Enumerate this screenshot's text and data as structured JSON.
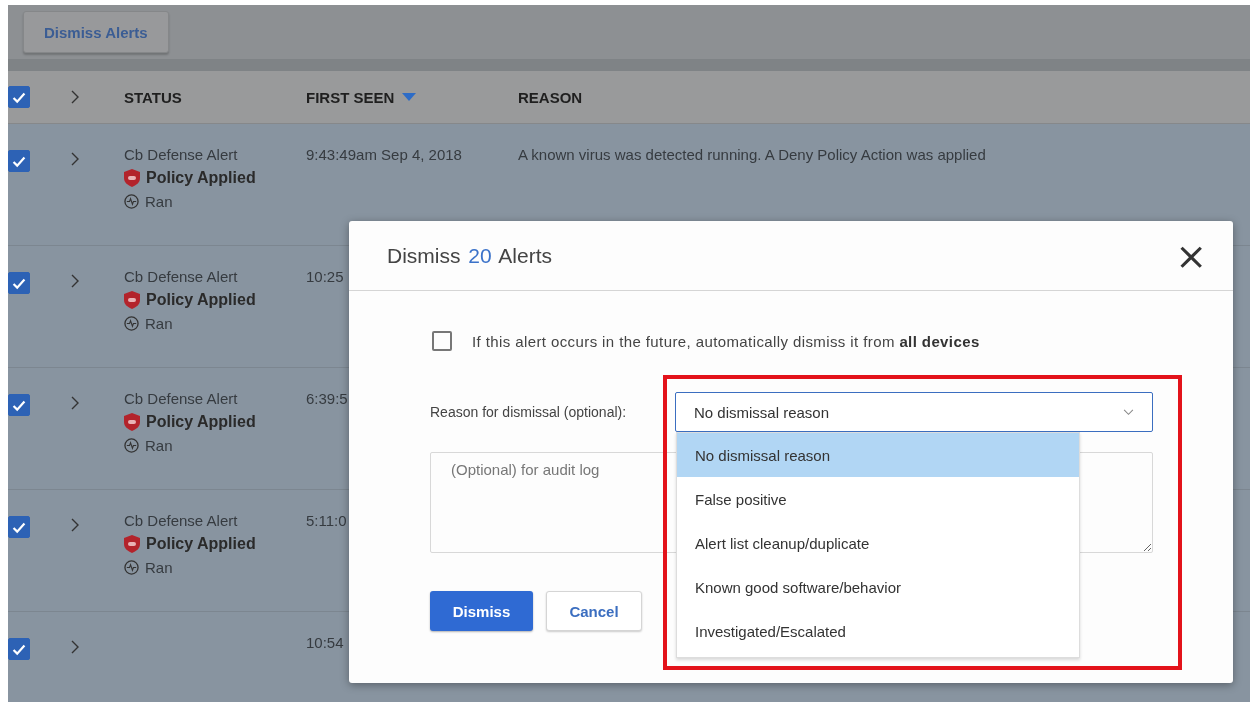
{
  "toolbar": {
    "dismiss_button": "Dismiss Alerts"
  },
  "table": {
    "select_all_checked": true,
    "columns": [
      {
        "label": "STATUS",
        "sorted": false
      },
      {
        "label": "FIRST SEEN",
        "sorted": true
      },
      {
        "label": "REASON",
        "sorted": false
      }
    ],
    "rows": [
      {
        "checked": true,
        "status": {
          "source": "Cb Defense Alert",
          "policy": "Policy Applied",
          "result": "Ran"
        },
        "first_seen": "9:43:49am Sep 4, 2018",
        "reason": "A known virus was detected running. A Deny Policy Action was applied"
      },
      {
        "checked": true,
        "status": {
          "source": "Cb Defense Alert",
          "policy": "Policy Applied",
          "result": "Ran"
        },
        "first_seen": "10:25"
      },
      {
        "checked": true,
        "status": {
          "source": "Cb Defense Alert",
          "policy": "Policy Applied",
          "result": "Ran"
        },
        "first_seen": "6:39:5"
      },
      {
        "checked": true,
        "status": {
          "source": "Cb Defense Alert",
          "policy": "Policy Applied",
          "result": "Ran"
        },
        "first_seen": "5:11:0"
      },
      {
        "checked": true,
        "first_seen": "10:54"
      }
    ]
  },
  "dialog": {
    "title_before": "Dismiss",
    "count": "20",
    "title_after": "Alerts",
    "close": "×",
    "auto_dismiss": {
      "checked": false,
      "label": "If this alert occurs in the future, automatically dismiss it from **all devices**"
    },
    "reason_label": "Reason for dismissal (optional):",
    "reason_select": {
      "value": "No dismissal reason",
      "expanded": true,
      "options": [
        {
          "label": "No dismissal reason",
          "selected": true
        },
        {
          "label": "False positive",
          "selected": false
        },
        {
          "label": "Alert list cleanup/duplicate",
          "selected": false
        },
        {
          "label": "Known good software/behavior",
          "selected": false
        },
        {
          "label": "Investigated/Escalated",
          "selected": false
        }
      ]
    },
    "notes": {
      "placeholder": "(Optional) for audit log"
    },
    "buttons": [
      {
        "label": "Dismiss",
        "kind": "primary"
      },
      {
        "label": "Cancel",
        "kind": "secondary"
      }
    ],
    "highlight": true
  }
}
